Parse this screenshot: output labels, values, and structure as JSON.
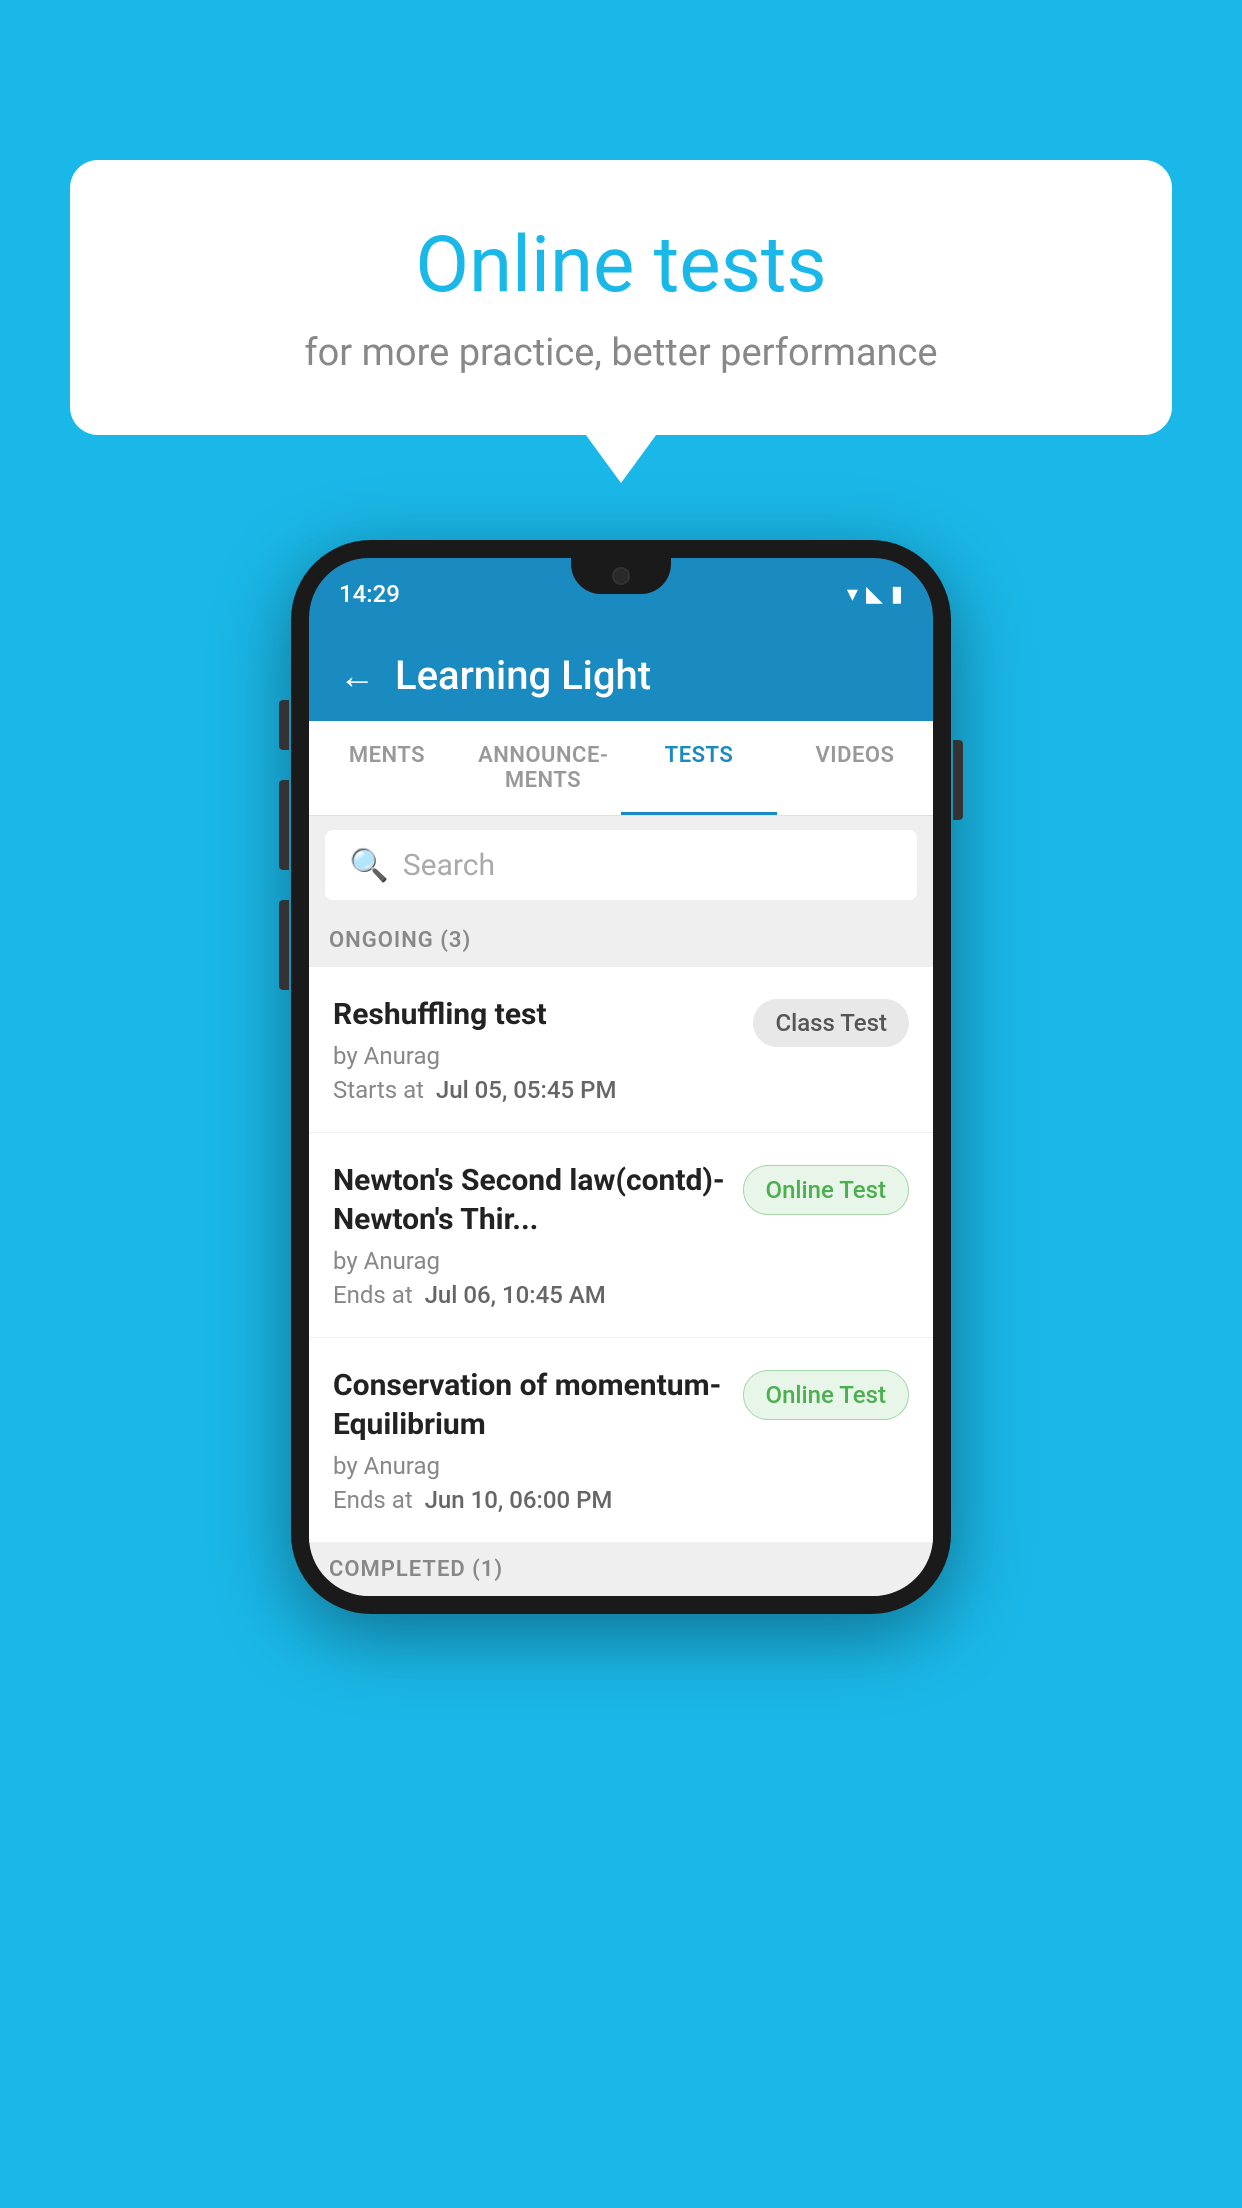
{
  "background_color": "#1ab8e8",
  "speech_bubble": {
    "title": "Online tests",
    "subtitle": "for more practice, better performance"
  },
  "phone": {
    "status_bar": {
      "time": "14:29",
      "icons": [
        "wifi",
        "signal",
        "battery"
      ]
    },
    "app_header": {
      "back_label": "←",
      "title": "Learning Light"
    },
    "tabs": [
      {
        "label": "MENTS",
        "active": false
      },
      {
        "label": "ANNOUNCEMENTS",
        "active": false
      },
      {
        "label": "TESTS",
        "active": true
      },
      {
        "label": "VIDEOS",
        "active": false
      }
    ],
    "search": {
      "placeholder": "Search"
    },
    "sections": [
      {
        "label": "ONGOING (3)",
        "items": [
          {
            "name": "Reshuffling test",
            "author": "by Anurag",
            "time_label": "Starts at",
            "time_value": "Jul 05, 05:45 PM",
            "badge": "Class Test",
            "badge_type": "class"
          },
          {
            "name": "Newton's Second law(contd)-Newton's Thir...",
            "author": "by Anurag",
            "time_label": "Ends at",
            "time_value": "Jul 06, 10:45 AM",
            "badge": "Online Test",
            "badge_type": "online"
          },
          {
            "name": "Conservation of momentum-Equilibrium",
            "author": "by Anurag",
            "time_label": "Ends at",
            "time_value": "Jun 10, 06:00 PM",
            "badge": "Online Test",
            "badge_type": "online"
          }
        ]
      },
      {
        "label": "COMPLETED (1)",
        "items": []
      }
    ]
  }
}
